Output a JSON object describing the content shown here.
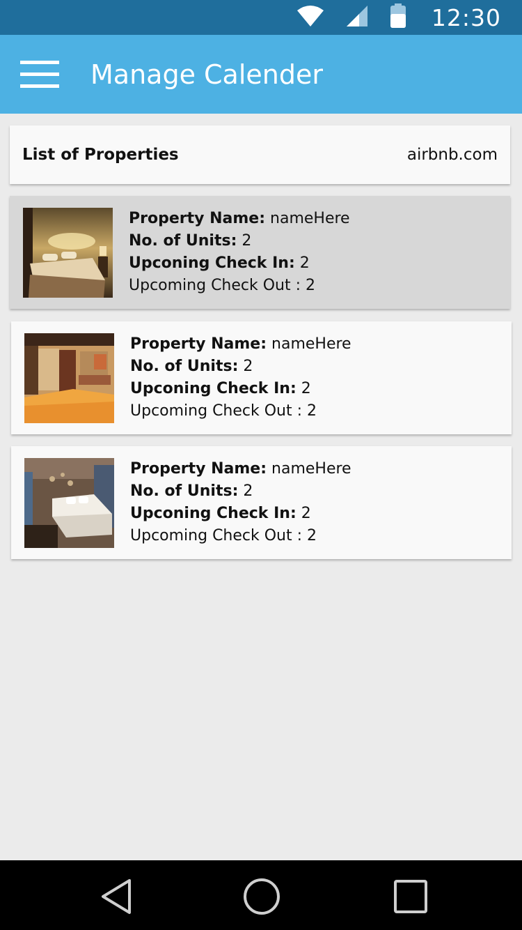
{
  "status_bar": {
    "time": "12:30",
    "icons": [
      "wifi-icon",
      "signal-icon",
      "battery-icon"
    ]
  },
  "app_bar": {
    "title": "Manage Calender",
    "menu_icon": "menu-icon"
  },
  "header": {
    "title": "List of Properties",
    "site": "airbnb.com"
  },
  "labels": {
    "property_name": "Property Name:",
    "units": "No. of Units:",
    "check_in": "Upconing Check In:",
    "check_out": "Upcoming Check Out"
  },
  "properties": [
    {
      "name": "nameHere",
      "units": "2",
      "check_in": "2",
      "check_out": ": 2",
      "selected": true
    },
    {
      "name": "nameHere",
      "units": "2",
      "check_in": "2",
      "check_out": ": 2",
      "selected": false
    },
    {
      "name": "nameHere",
      "units": "2",
      "check_in": "2",
      "check_out": ": 2",
      "selected": false
    }
  ],
  "nav_bar": {
    "icons": [
      "back-icon",
      "home-icon",
      "recents-icon"
    ]
  },
  "colors": {
    "status_bar": "#1f6e9c",
    "app_bar": "#4db1e3",
    "background": "#ebebeb",
    "selected_card": "#d7d7d7"
  }
}
